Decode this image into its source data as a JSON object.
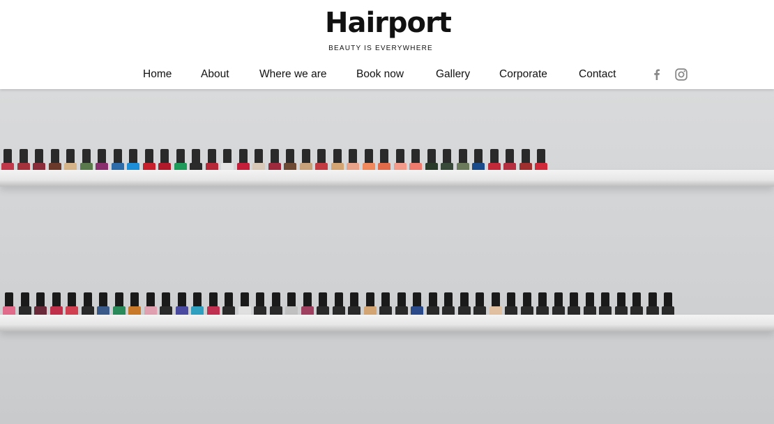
{
  "brand": {
    "name": "Hairport",
    "tagline": "BEAUTY IS EVERYWHERE"
  },
  "nav": {
    "items": [
      {
        "label": "Home"
      },
      {
        "label": "About"
      },
      {
        "label": "Where we are"
      },
      {
        "label": "Book now"
      },
      {
        "label": "Gallery"
      },
      {
        "label": "Corporate"
      },
      {
        "label": "Contact"
      }
    ]
  },
  "social": [
    {
      "icon": "facebook-icon"
    },
    {
      "icon": "instagram-icon"
    }
  ],
  "colors": {
    "text": "#111111",
    "icon_gray": "#888888",
    "wall": "#d6d7d8",
    "shelf": "#eeeeee"
  },
  "hero": {
    "image": "nail-polish-shelves",
    "top_shelf_colors": [
      "#c0394a",
      "#a3323d",
      "#8b2c3a",
      "#6b3a2a",
      "#d6b48a",
      "#5a7a4e",
      "#8a2f6e",
      "#2d6ca8",
      "#1d8fd8",
      "#c81f2d",
      "#b01a2a",
      "#1f9a5a",
      "#2b2b2b",
      "#b62737",
      "#e5e5e5",
      "#c41e3a",
      "#d8c8b8",
      "#9e2a3d",
      "#6e4a34",
      "#c8a27a",
      "#c33b42",
      "#d4a574",
      "#e9a38a",
      "#f08a5e",
      "#e26b4a",
      "#f29b8a",
      "#ef7a6e",
      "#2a3a2a",
      "#3a4a3a",
      "#6b7b5b",
      "#1a4a8a",
      "#c22a3a",
      "#b43040",
      "#a03030",
      "#d02a3a"
    ],
    "bottom_shelf_colors": [
      "#e06b8a",
      "#2a2a2a",
      "#6a2a3a",
      "#c0304a",
      "#d04050",
      "#2a2a2a",
      "#3a5a8a",
      "#2a8a5a",
      "#c87a2a",
      "#e0a0b0",
      "#2a2a2a",
      "#4a4aa0",
      "#30a0c0",
      "#c03050",
      "#2a2a2a",
      "#e0e0e0",
      "#2a2a2a",
      "#2a2a2a",
      "#c0c0c0",
      "#a04060",
      "#2a2a2a",
      "#2a2a2a",
      "#2a2a2a",
      "#d4a574",
      "#2a2a2a",
      "#2a2a2a",
      "#2a4a8a",
      "#2a2a2a",
      "#2a2a2a",
      "#2a2a2a",
      "#2a2a2a",
      "#e0c0a0",
      "#2a2a2a",
      "#2a2a2a",
      "#2a2a2a",
      "#2a2a2a",
      "#2a2a2a",
      "#2a2a2a",
      "#2a2a2a",
      "#2a2a2a",
      "#2a2a2a",
      "#2a2a2a",
      "#2a2a2a"
    ]
  }
}
